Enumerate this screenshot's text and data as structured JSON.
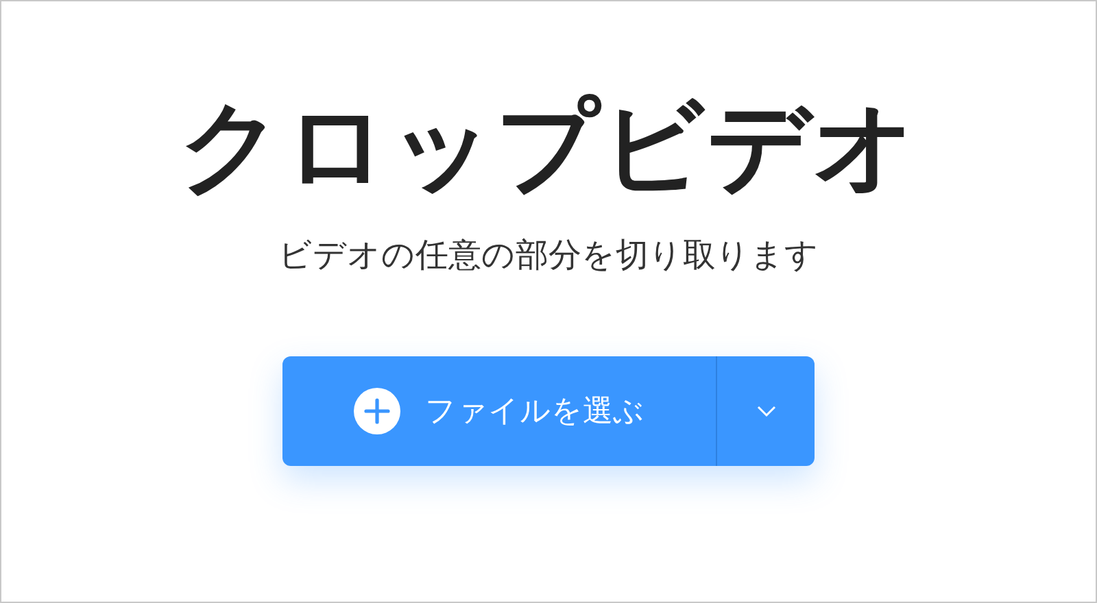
{
  "title": "クロップビデオ",
  "subtitle": "ビデオの任意の部分を切り取ります",
  "upload_button": {
    "label": "ファイルを選ぶ"
  }
}
